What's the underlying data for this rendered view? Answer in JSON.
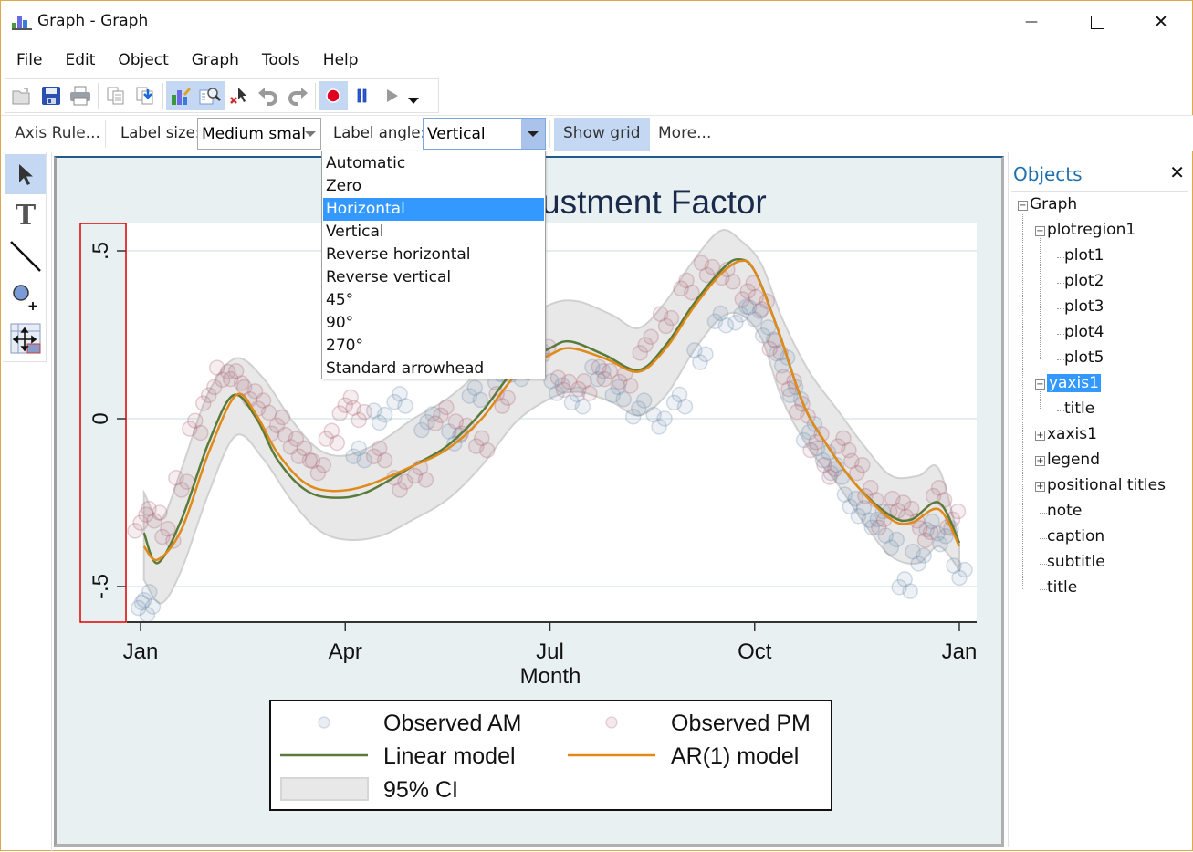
{
  "window": {
    "title": "Graph - Graph",
    "controls": {
      "minimize": "—",
      "maximize": "☐",
      "close": "✕"
    }
  },
  "menu": [
    "File",
    "Edit",
    "Object",
    "Graph",
    "Tools",
    "Help"
  ],
  "toolbar": {
    "buttons": [
      {
        "name": "open-icon",
        "active": false
      },
      {
        "name": "save-icon",
        "active": false
      },
      {
        "name": "print-icon",
        "active": false
      },
      {
        "name": "copy-icon",
        "active": false
      },
      {
        "name": "paste-icon",
        "active": false
      },
      {
        "name": "graph-editor-icon",
        "active": true
      },
      {
        "name": "object-browser-icon",
        "active": true
      },
      {
        "name": "delete-object-icon",
        "active": false
      },
      {
        "name": "undo-icon",
        "active": false
      },
      {
        "name": "redo-icon",
        "active": false
      },
      {
        "name": "record-icon",
        "active": true
      },
      {
        "name": "pause-icon",
        "active": false
      },
      {
        "name": "play-icon",
        "active": false
      }
    ]
  },
  "propbar": {
    "axis_rule": "Axis Rule...",
    "label_size_label": "Label size:",
    "label_size_value": "Medium smal",
    "label_angle_label": "Label angle:",
    "label_angle_value": "Vertical",
    "show_grid": "Show grid",
    "more": "More..."
  },
  "dropdown": {
    "options": [
      "Automatic",
      "Zero",
      "Horizontal",
      "Vertical",
      "Reverse horizontal",
      "Reverse vertical",
      "45°",
      "90°",
      "270°",
      "Standard arrowhead"
    ],
    "highlighted": "Horizontal"
  },
  "tools": [
    "pointer-tool",
    "text-tool",
    "line-tool",
    "marker-tool",
    "grid-edit-tool"
  ],
  "objects_panel": {
    "title": "Objects",
    "close": "✕",
    "tree": [
      {
        "label": "Graph",
        "level": 0,
        "expander": "minus"
      },
      {
        "label": "plotregion1",
        "level": 1,
        "expander": "minus"
      },
      {
        "label": "plot1",
        "level": 2
      },
      {
        "label": "plot2",
        "level": 2
      },
      {
        "label": "plot3",
        "level": 2
      },
      {
        "label": "plot4",
        "level": 2
      },
      {
        "label": "plot5",
        "level": 2
      },
      {
        "label": "yaxis1",
        "level": 1,
        "expander": "minus",
        "selected": true
      },
      {
        "label": "title",
        "level": 2
      },
      {
        "label": "xaxis1",
        "level": 1,
        "expander": "plus"
      },
      {
        "label": "legend",
        "level": 1,
        "expander": "plus"
      },
      {
        "label": "positional titles",
        "level": 1,
        "expander": "plus"
      },
      {
        "label": "note",
        "level": 1
      },
      {
        "label": "caption",
        "level": 1
      },
      {
        "label": "subtitle",
        "level": 1
      },
      {
        "label": "title",
        "level": 1
      }
    ]
  },
  "colors": {
    "linear": "#5a7a3a",
    "ar1": "#e08a1a",
    "ci_fill": "#e8e8e8",
    "ci_edge": "#d0d0d0",
    "am": "#6f8faf",
    "pm": "#b06a78",
    "title": "#1a2a4a",
    "selection": "#e00000"
  },
  "chart_data": {
    "type": "line",
    "title": "ustment Factor",
    "xlabel": "Month",
    "ylabel": "",
    "x_ticks": [
      {
        "value": 0,
        "label": "Jan"
      },
      {
        "value": 3,
        "label": "Apr"
      },
      {
        "value": 6,
        "label": "Jul"
      },
      {
        "value": 9,
        "label": "Oct"
      },
      {
        "value": 12,
        "label": "Jan"
      }
    ],
    "y_ticks": [
      {
        "value": 0.5,
        "label": ".5"
      },
      {
        "value": 0,
        "label": "0"
      },
      {
        "value": -0.5,
        "label": "-.5"
      }
    ],
    "xlim": [
      -0.75,
      12.25
    ],
    "ylim": [
      -0.6,
      0.58
    ],
    "grid": true,
    "legend_position": "bottom",
    "legend": [
      "Observed AM",
      "Observed PM",
      "Linear model",
      "AR(1) model",
      "95% CI"
    ],
    "series": [
      {
        "name": "Linear model",
        "x": [
          0.05,
          0.25,
          0.6,
          1.0,
          1.36,
          1.7,
          2.0,
          2.4,
          2.8,
          3.3,
          4.0,
          4.5,
          5.0,
          5.5,
          6.0,
          6.3,
          6.8,
          7.3,
          7.7,
          8.1,
          8.5,
          8.75,
          9.0,
          9.35,
          9.7,
          10.0,
          10.5,
          11.0,
          11.3,
          11.7,
          12.0
        ],
        "y": [
          -0.34,
          -0.43,
          -0.3,
          -0.07,
          0.07,
          0.0,
          -0.12,
          -0.21,
          -0.235,
          -0.22,
          -0.14,
          -0.08,
          0.02,
          0.15,
          0.21,
          0.23,
          0.19,
          0.145,
          0.22,
          0.34,
          0.44,
          0.475,
          0.44,
          0.26,
          0.05,
          -0.06,
          -0.2,
          -0.29,
          -0.3,
          -0.25,
          -0.37
        ]
      },
      {
        "name": "AR(1) model",
        "x": [
          0.05,
          0.25,
          0.6,
          1.0,
          1.4,
          1.7,
          2.0,
          2.4,
          2.8,
          3.3,
          4.0,
          4.5,
          5.0,
          5.5,
          6.0,
          6.3,
          6.8,
          7.3,
          7.7,
          8.1,
          8.5,
          8.8,
          9.0,
          9.35,
          9.7,
          10.0,
          10.5,
          11.0,
          11.3,
          11.7,
          12.0
        ],
        "y": [
          -0.38,
          -0.42,
          -0.33,
          -0.1,
          0.07,
          0.01,
          -0.1,
          -0.19,
          -0.215,
          -0.2,
          -0.14,
          -0.09,
          0.0,
          0.13,
          0.19,
          0.21,
          0.18,
          0.14,
          0.21,
          0.33,
          0.43,
          0.47,
          0.44,
          0.26,
          0.05,
          -0.06,
          -0.2,
          -0.3,
          -0.31,
          -0.27,
          -0.38
        ]
      },
      {
        "name": "95% CI upper",
        "x": [
          0.05,
          0.3,
          0.6,
          1.0,
          1.4,
          1.8,
          2.2,
          2.6,
          3.0,
          3.5,
          4.0,
          4.5,
          5.0,
          5.5,
          6.0,
          6.4,
          6.9,
          7.3,
          7.7,
          8.1,
          8.5,
          8.8,
          9.1,
          9.4,
          9.8,
          10.2,
          10.6,
          11.0,
          11.4,
          11.7,
          12.0
        ],
        "y": [
          -0.22,
          -0.3,
          -0.15,
          0.08,
          0.18,
          0.12,
          0.0,
          -0.09,
          -0.11,
          -0.07,
          0.0,
          0.06,
          0.15,
          0.27,
          0.34,
          0.35,
          0.31,
          0.27,
          0.35,
          0.47,
          0.56,
          0.53,
          0.46,
          0.3,
          0.14,
          0.03,
          -0.08,
          -0.17,
          -0.17,
          -0.15,
          -0.37
        ]
      },
      {
        "name": "95% CI lower",
        "x": [
          0.05,
          0.3,
          0.6,
          1.0,
          1.4,
          1.8,
          2.2,
          2.6,
          3.0,
          3.5,
          4.0,
          4.5,
          5.0,
          5.5,
          6.0,
          6.4,
          6.9,
          7.3,
          7.7,
          8.1,
          8.5,
          8.8,
          9.1,
          9.4,
          9.8,
          10.2,
          10.6,
          11.0,
          11.4,
          11.7,
          12.0
        ],
        "y": [
          -0.48,
          -0.55,
          -0.45,
          -0.22,
          -0.05,
          -0.12,
          -0.24,
          -0.33,
          -0.36,
          -0.35,
          -0.3,
          -0.24,
          -0.14,
          -0.01,
          0.06,
          0.08,
          0.05,
          0.01,
          0.07,
          0.2,
          0.3,
          0.31,
          0.24,
          0.06,
          -0.09,
          -0.19,
          -0.31,
          -0.41,
          -0.43,
          -0.38,
          -0.45
        ]
      },
      {
        "name": "Observed AM",
        "type": "scatter",
        "x": [
          0.05,
          0.1,
          3.2,
          3.5,
          3.8,
          4.2,
          4.6,
          4.9,
          5.2,
          5.5,
          5.8,
          6.1,
          6.4,
          6.7,
          7.0,
          7.3,
          7.6,
          7.9,
          8.2,
          8.5,
          8.8,
          9.0,
          9.2,
          9.4,
          9.6,
          9.8,
          10.0,
          10.2,
          10.4,
          10.6,
          10.8,
          11.0,
          11.2,
          11.4,
          11.6,
          11.8,
          12.0
        ],
        "y": [
          -0.54,
          -0.56,
          -0.1,
          0.0,
          0.05,
          -0.01,
          -0.05,
          0.08,
          0.12,
          0.13,
          0.18,
          0.1,
          0.06,
          0.13,
          0.07,
          0.03,
          0.0,
          0.06,
          0.18,
          0.29,
          0.31,
          0.32,
          0.26,
          0.17,
          0.07,
          -0.04,
          -0.1,
          -0.15,
          -0.25,
          -0.29,
          -0.3,
          -0.36,
          -0.49,
          -0.42,
          -0.33,
          -0.35,
          -0.45
        ]
      },
      {
        "name": "Observed PM",
        "type": "scatter",
        "x": [
          0.0,
          0.2,
          0.4,
          0.6,
          0.8,
          1.0,
          1.2,
          1.4,
          1.6,
          1.8,
          2.0,
          2.2,
          2.4,
          2.6,
          2.8,
          3.0,
          3.2,
          3.5,
          3.8,
          4.1,
          4.4,
          4.7,
          5.0,
          5.3,
          5.6,
          5.9,
          6.2,
          6.5,
          6.8,
          7.1,
          7.4,
          7.7,
          8.0,
          8.3,
          8.6,
          8.9,
          9.1,
          9.3,
          9.5,
          9.7,
          9.9,
          10.1,
          10.3,
          10.5,
          10.7,
          10.9,
          11.1,
          11.3,
          11.5,
          11.7,
          11.9
        ],
        "y": [
          -0.31,
          -0.28,
          -0.34,
          -0.2,
          -0.03,
          0.07,
          0.14,
          0.13,
          0.07,
          0.03,
          -0.02,
          -0.06,
          -0.1,
          -0.15,
          -0.06,
          0.04,
          0.02,
          -0.1,
          -0.2,
          -0.17,
          0.01,
          -0.02,
          -0.07,
          0.05,
          0.15,
          0.19,
          0.11,
          0.1,
          0.13,
          0.11,
          0.22,
          0.3,
          0.4,
          0.44,
          0.42,
          0.38,
          0.35,
          0.22,
          0.1,
          0.02,
          -0.07,
          -0.15,
          -0.07,
          -0.15,
          -0.23,
          -0.3,
          -0.25,
          -0.28,
          -0.35,
          -0.23,
          -0.3
        ]
      }
    ]
  }
}
